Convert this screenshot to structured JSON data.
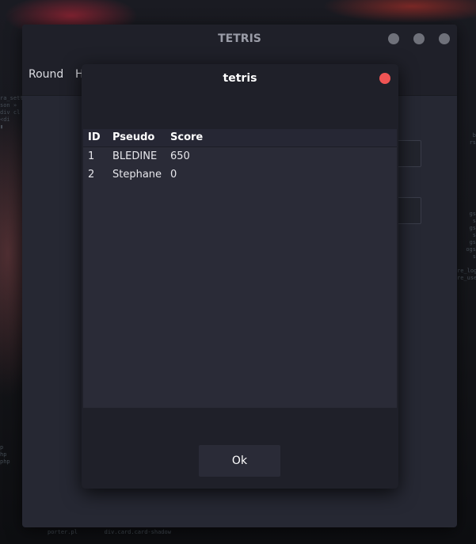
{
  "main_window": {
    "title": "TETRIS",
    "menu": [
      "Round",
      "H"
    ]
  },
  "dialog": {
    "title": "tetris",
    "columns": [
      "ID",
      "Pseudo",
      "Score"
    ],
    "rows": [
      {
        "id": "1",
        "pseudo": "BLEDINE",
        "score": "650"
      },
      {
        "id": "2",
        "pseudo": "Stephane",
        "score": "0"
      }
    ],
    "ok_label": "Ok"
  },
  "backdrop": {
    "code_left": "ra_setti\nson »\ndiv cl\n<di\n▮\n\n\n\n\n\n\n\n\n\n\n\n\n\n\n\n\n\n\n\n\n\n\n\n\n\n\n\n\n\n\n\n\n\n\n\n\n\n\n\n\n\n\n\n\np\nhp\nphp",
    "code_right": "\n\n\nb\nrs\n\n\n\n\n\n\n\n\n\ngs\ns\ngs\ns\ngs\nogs\ns\n\nre_logs\nre_users",
    "code_bottom": "porter.pl        div.card.card-shadow"
  },
  "colors": {
    "dialog_close": "#f05454",
    "window_control": "#6f717a",
    "window_bg": "#262833",
    "dialog_bg": "#1f2029"
  }
}
